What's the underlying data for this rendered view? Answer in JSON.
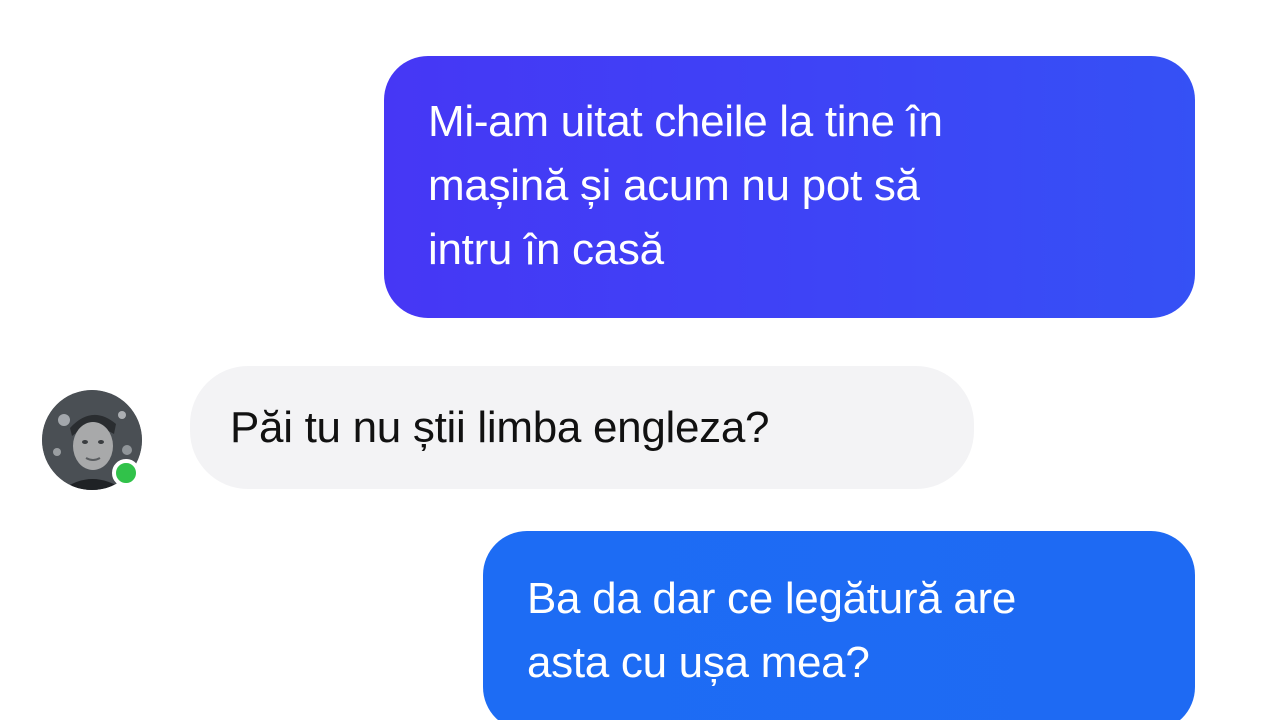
{
  "messages": [
    {
      "direction": "outgoing",
      "lines": [
        "Mi-am uitat cheile la tine în",
        "mașină și acum nu pot să",
        "intru în casă"
      ]
    },
    {
      "direction": "incoming",
      "text": "Păi tu nu știi limba engleza?"
    },
    {
      "direction": "outgoing",
      "lines": [
        "Ba da dar ce legătură are",
        "asta cu ușa mea?"
      ]
    }
  ],
  "contact": {
    "avatar_icon": "user-avatar",
    "online": true,
    "online_color": "#31c24a"
  },
  "colors": {
    "outgoing_bubble_1": "#3d45f6",
    "outgoing_bubble_2": "#1e6af3",
    "incoming_bubble": "#f3f3f5"
  }
}
